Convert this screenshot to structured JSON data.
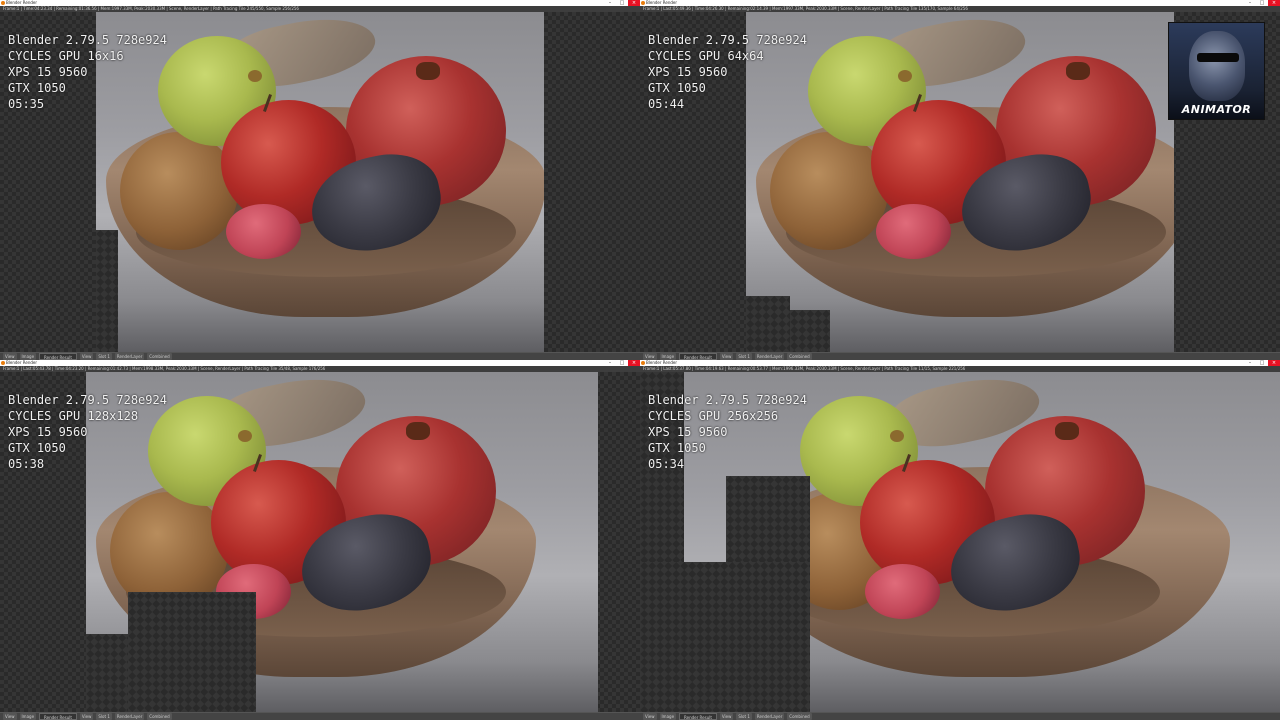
{
  "window": {
    "title": "Blender Render",
    "minimize": "–",
    "maximize": "□",
    "close": "×"
  },
  "panels": [
    {
      "status": "Frame:1 | Time:04:23.34 | Remaining:01:36.56 | Mem:1997.33M, Peak:2030.33M | Scene, RenderLayer | Path Tracing Tile 245/550, Sample 256/256",
      "overlay": [
        "Blender 2.79.5 728e924",
        "CYCLES GPU 16x16",
        "XPS 15 9560",
        "GTX 1050",
        "05:35"
      ],
      "bottombar": [
        "View",
        "Image",
        "Render Result",
        "View",
        "Slot 1",
        "RenderLayer",
        "Combined"
      ]
    },
    {
      "status": "Frame:1 | Last:05:49.36 | Time:04:26.30 | Remaining:02:14.39 | Mem:1997.33M, Peak:2030.33M | Scene, RenderLayer | Path Tracing Tile 135/170, Sample 64/256",
      "overlay": [
        "Blender 2.79.5 728e924",
        "CYCLES GPU 64x64",
        "XPS 15 9560",
        "GTX 1050",
        "05:44"
      ],
      "bottombar": [
        "View",
        "Image",
        "Render Result",
        "View",
        "Slot 1",
        "RenderLayer",
        "Combined"
      ]
    },
    {
      "status": "Frame:1 | Last:05:43.78 | Time:04:23.20 | Remaining:01:42.73 | Mem:1998.33M, Peak:2030.33M | Scene, RenderLayer | Path Tracing Tile 35/48, Sample 176/256",
      "overlay": [
        "Blender 2.79.5 728e924",
        "CYCLES GPU 128x128",
        "XPS 15 9560",
        "GTX 1050",
        "05:38"
      ],
      "bottombar": [
        "View",
        "Image",
        "Render Result",
        "View",
        "Slot 1",
        "RenderLayer",
        "Combined"
      ]
    },
    {
      "status": "Frame:1 | Last:05:37.80 | Time:04:19.63 | Remaining:00:53.77 | Mem:1996.33M, Peak:2030.33M | Scene, RenderLayer | Path Tracing Tile 11/15, Sample 221/256",
      "overlay": [
        "Blender 2.79.5 728e924",
        "CYCLES GPU 256x256",
        "XPS 15 9560",
        "GTX 1050",
        "05:34"
      ],
      "bottombar": [
        "View",
        "Image",
        "Render Result",
        "View",
        "Slot 1",
        "RenderLayer",
        "Combined"
      ]
    }
  ],
  "logo": {
    "text": "ANIMATOR"
  },
  "colors": {
    "titlebar_bg": "#ffffff",
    "close_button": "#e81123",
    "statusbar_bg": "#3d3d3d",
    "overlay_text": "#f0f0f0",
    "blender_orange": "#e87d0d"
  }
}
